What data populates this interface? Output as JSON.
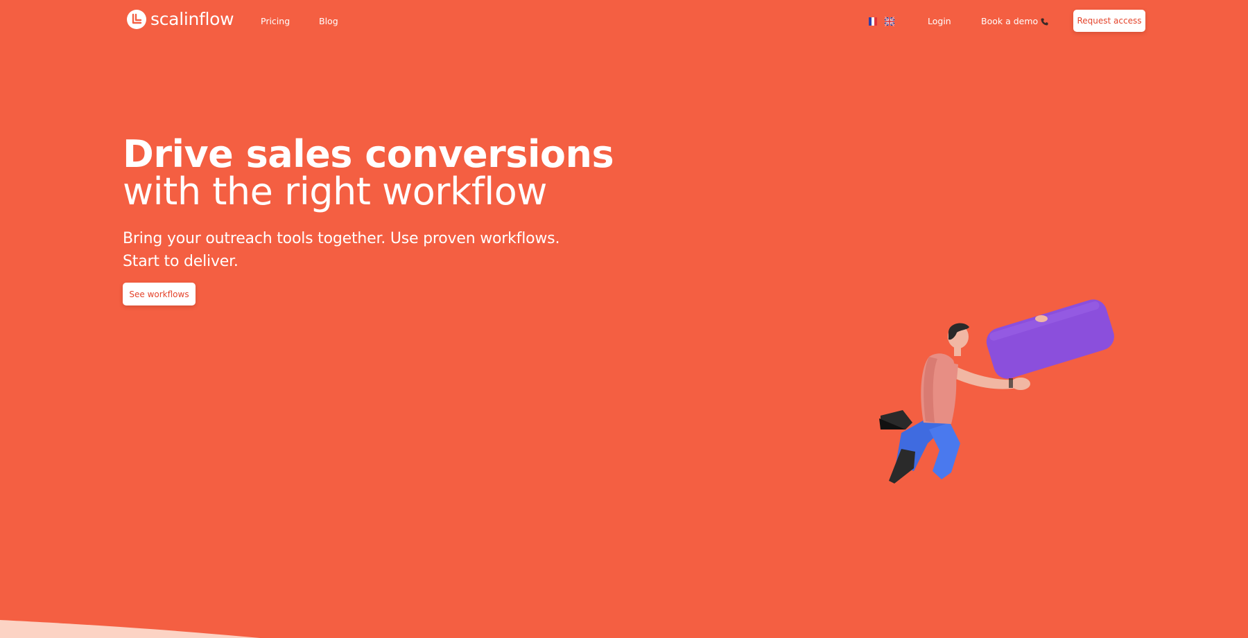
{
  "brand": {
    "name": "scalinflow",
    "logo_icon": "scalinflow-logo-icon"
  },
  "nav": {
    "pricing_label": "Pricing",
    "blog_label": "Blog",
    "login_label": "Login",
    "book_demo_label": "Book a demo",
    "book_demo_icon": "phone-icon",
    "request_access_label": "Request access",
    "language_flags": [
      "fr-flag-icon",
      "gb-flag-icon"
    ]
  },
  "hero": {
    "title_line1": "Drive sales conversions",
    "title_line2": "with the right workflow",
    "subtitle_line1": "Bring your outreach tools together. Use proven workflows.",
    "subtitle_line2": "Start to deliver.",
    "cta_label": "See workflows",
    "illustration": "flying-man-holding-purple-bar"
  },
  "colors": {
    "background": "#f45f42",
    "text": "#ffffff",
    "button_bg": "#ffffff",
    "button_text": "#e4432a",
    "illustration_accent": "#8b4fdc",
    "wedge": "#fcd3c4"
  }
}
